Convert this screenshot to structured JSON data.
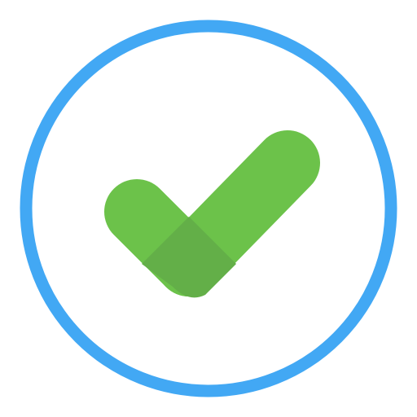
{
  "icon": {
    "name": "check-circle-icon",
    "ring_color": "#42A8F4",
    "background_color": "#FFFFFF",
    "check_color": "#6CC24A",
    "check_overlap_color": "#63AF48"
  }
}
